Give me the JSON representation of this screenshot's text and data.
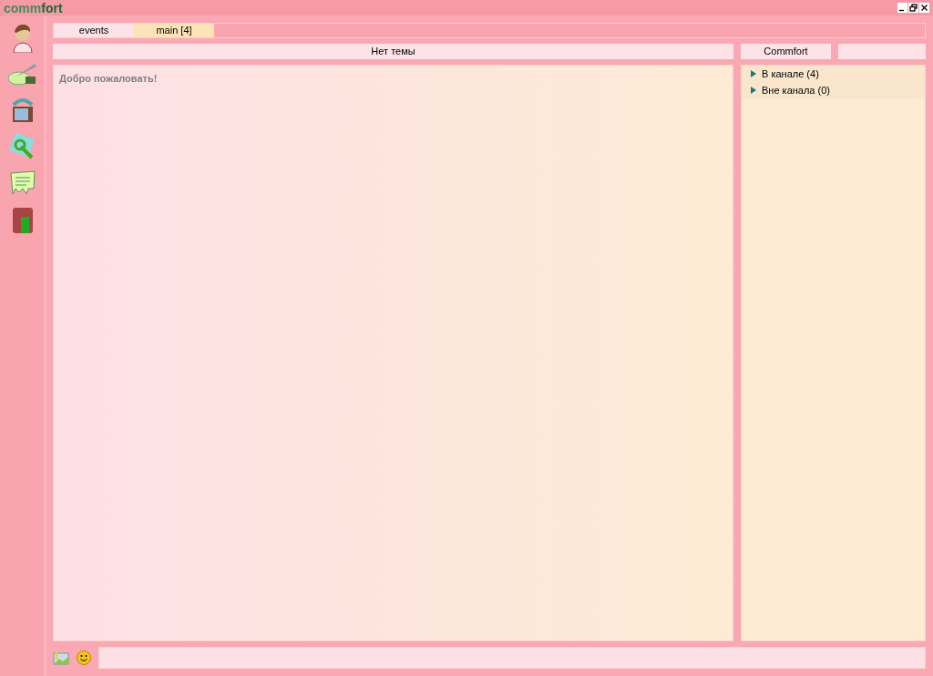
{
  "logo": {
    "light": "comm",
    "dark": "fort"
  },
  "tabs": [
    {
      "label": "events",
      "selected": false
    },
    {
      "label": "main [4]",
      "selected": true
    }
  ],
  "topic": "Нет темы",
  "channel_name": "Commfort",
  "messages": [
    "Добро пожаловать!"
  ],
  "user_groups": [
    {
      "label": "В канале (4)",
      "expanded": false
    },
    {
      "label": "Вне канала (0)",
      "expanded": false
    }
  ]
}
